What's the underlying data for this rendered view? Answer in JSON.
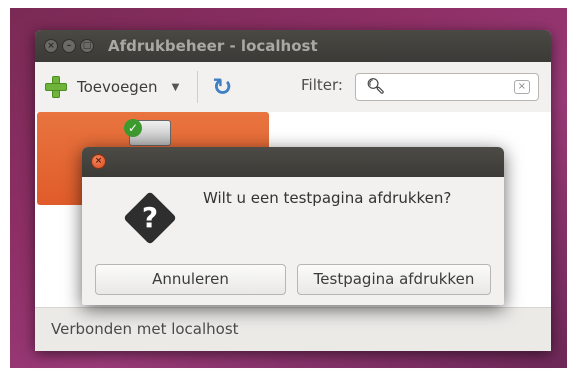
{
  "window": {
    "title": "Afdrukbeheer - localhost"
  },
  "toolbar": {
    "add_label": "Toevoegen",
    "filter_label": "Filter:",
    "search_value": ""
  },
  "icons": {
    "add": "plus-icon",
    "dropdown": "chevron-down-icon",
    "refresh": "refresh-icon",
    "search": "magnifier-icon",
    "clear": "clear-icon",
    "printer": "printer-icon",
    "printer_status": "checkmark-icon",
    "dialog_question": "question-icon",
    "dialog_close": "close-icon"
  },
  "statusbar": {
    "text": "Verbonden met localhost"
  },
  "dialog": {
    "message": "Wilt u een testpagina afdrukken?",
    "cancel_label": "Annuleren",
    "confirm_label": "Testpagina afdrukken"
  },
  "colors": {
    "titlebar": "#3c3b37",
    "selected_printer": "#e05c2a",
    "desktop": "#8e2f66",
    "refresh_icon": "#3f7fc4",
    "add_icon": "#6fb43a"
  }
}
